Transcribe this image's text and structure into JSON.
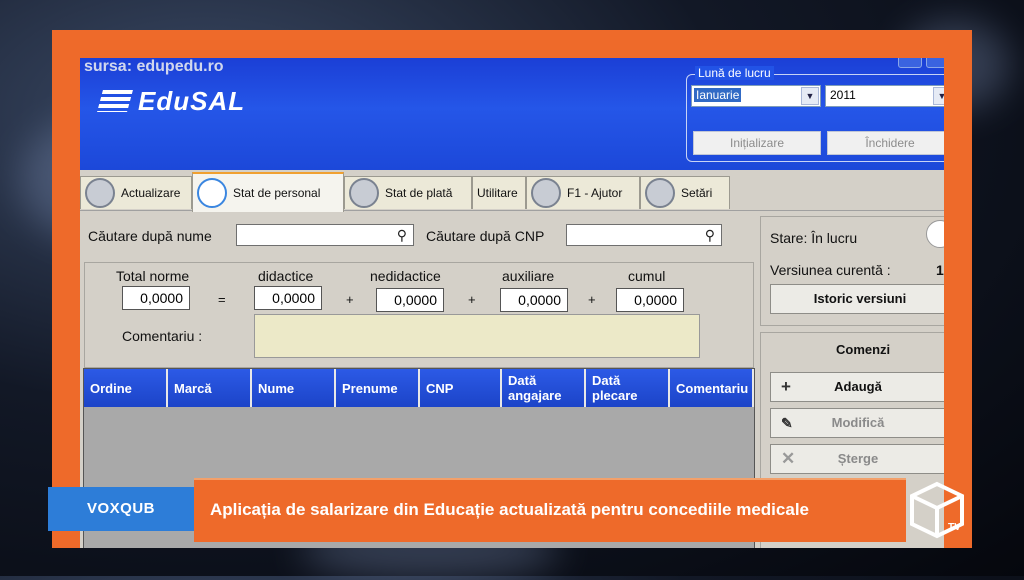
{
  "source": "sursa: edupedu.ro",
  "app": {
    "logo_text": "EduSAL",
    "month_group": {
      "legend": "Lună de lucru",
      "month": "Ianuarie",
      "year": "2011",
      "init_button": "Inițializare",
      "close_button": "Închidere"
    },
    "tabs": [
      {
        "label": "Actualizare",
        "icon": "refresh-icon"
      },
      {
        "label": "Stat de personal",
        "icon": "person-icon"
      },
      {
        "label": "Stat de plată",
        "icon": "list-icon"
      },
      {
        "label": "Utilitare",
        "icon": ""
      },
      {
        "label": "F1 - Ajutor",
        "icon": "help-icon"
      },
      {
        "label": "Setări",
        "icon": "gear-icon"
      }
    ],
    "search": {
      "by_name_label": "Căutare după nume",
      "by_name_value": "",
      "by_cnp_label": "Căutare după CNP",
      "by_cnp_value": ""
    },
    "norms": {
      "total_label": "Total norme",
      "total_value": "0,0000",
      "didactice_label": "didactice",
      "didactice_value": "0,0000",
      "nedidactice_label": "nedidactice",
      "nedidactice_value": "0,0000",
      "auxiliare_label": "auxiliare",
      "auxiliare_value": "0,0000",
      "cumul_label": "cumul",
      "cumul_value": "0,0000",
      "equals": "=",
      "plus": "+",
      "comment_label": "Comentariu :",
      "comment_value": ""
    },
    "grid_columns": [
      "Ordine",
      "Marcă",
      "Nume",
      "Prenume",
      "CNP",
      "Dată angajare",
      "Dată plecare",
      "Comentariu"
    ],
    "status": {
      "state": "Stare: În lucru",
      "version_label": "Versiunea curentă :",
      "version_value": "1",
      "history_button": "Istoric versiuni"
    },
    "commands": {
      "title": "Comenzi",
      "add": "Adaugă",
      "edit": "Modifică",
      "delete": "Șterge"
    }
  },
  "banner": {
    "brand": "VOXQUB",
    "headline": "Aplicația de salarizare din Educație actualizată pentru concediile medicale",
    "tv_badge": "TV"
  },
  "colors": {
    "frame_orange": "#ee6a2a",
    "header_blue": "#2253e6",
    "grid_header_blue": "#2c5ae6",
    "brand_blue": "#2d7dd8"
  }
}
